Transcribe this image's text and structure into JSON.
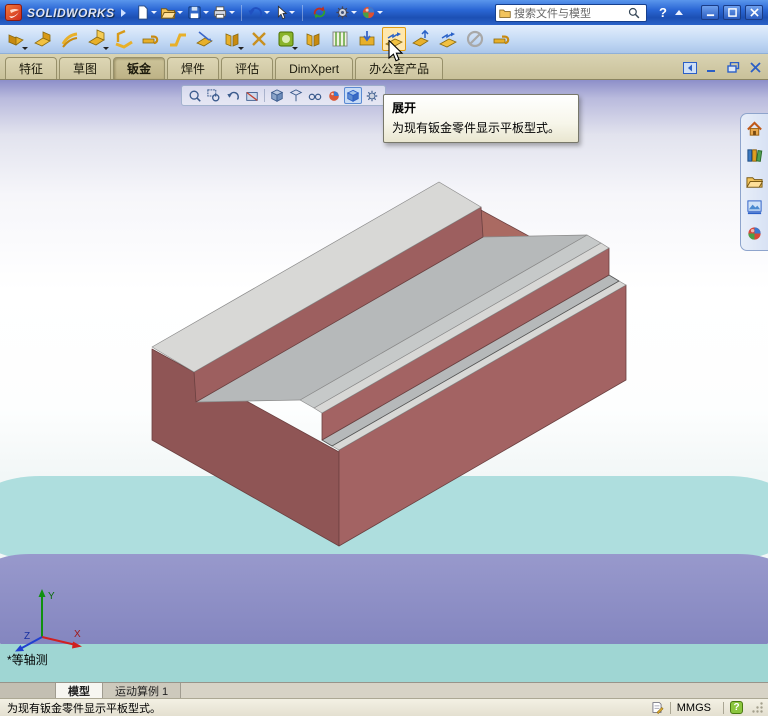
{
  "titlebar": {
    "app_name": "SOLIDWORKS",
    "search_placeholder": "搜索文件与模型",
    "help_label": "?"
  },
  "toolbars": {
    "menu_tools": [
      "new",
      "open",
      "save",
      "print",
      "undo",
      "select",
      "rebuild",
      "options",
      "edit-appearance"
    ],
    "sheet_metal_tools": [
      "base-flange",
      "convert-to-sheet-metal",
      "lofted-bend",
      "edge-flange",
      "miter-flange",
      "hem",
      "jog",
      "sketched-bend",
      "closed-corner",
      "corner-trim",
      "forming-tool",
      "sheet-metal-gusset",
      "vent",
      "extruded-cut",
      "unfold",
      "fold",
      "flatten",
      "no-bends",
      "insert-bends"
    ],
    "hovered_tool": "unfold"
  },
  "command_manager": {
    "tabs": [
      {
        "label": "特征",
        "active": false
      },
      {
        "label": "草图",
        "active": false
      },
      {
        "label": "钣金",
        "active": true
      },
      {
        "label": "焊件",
        "active": false
      },
      {
        "label": "评估",
        "active": false
      },
      {
        "label": "DimXpert",
        "active": false
      },
      {
        "label": "办公室产品",
        "active": false
      }
    ]
  },
  "headsup": {
    "tools": [
      "zoom-fit",
      "zoom-area",
      "previous-view",
      "section-view",
      "view-orientation",
      "display-style",
      "hide-show-items",
      "edit-appearance",
      "apply-scene",
      "view-settings"
    ],
    "active_tool": "apply-scene"
  },
  "tooltip": {
    "title": "展开",
    "description": "为现有钣金零件显示平板型式。"
  },
  "task_pane": {
    "items": [
      "solidworks-resources",
      "design-library",
      "file-explorer",
      "view-palette",
      "appearances"
    ]
  },
  "viewport": {
    "orientation_label": "*等轴测",
    "triad_labels": {
      "x": "X",
      "y": "Y",
      "z": "Z"
    }
  },
  "bottom_tabs": {
    "tabs": [
      {
        "label": "模型",
        "active": true
      },
      {
        "label": "运动算例 1",
        "active": false
      }
    ]
  },
  "statusbar": {
    "message": "为现有钣金零件显示平板型式。",
    "units": "MMGS",
    "help_label": "?"
  },
  "part": {
    "face_color": "#a36363",
    "near_cap_color": "#8f5555",
    "far_cap_color": "#aa6a62",
    "hem_color": "#9d5f5f",
    "top_color": "#d8d8d6",
    "web_color": "#b6b9ba"
  }
}
